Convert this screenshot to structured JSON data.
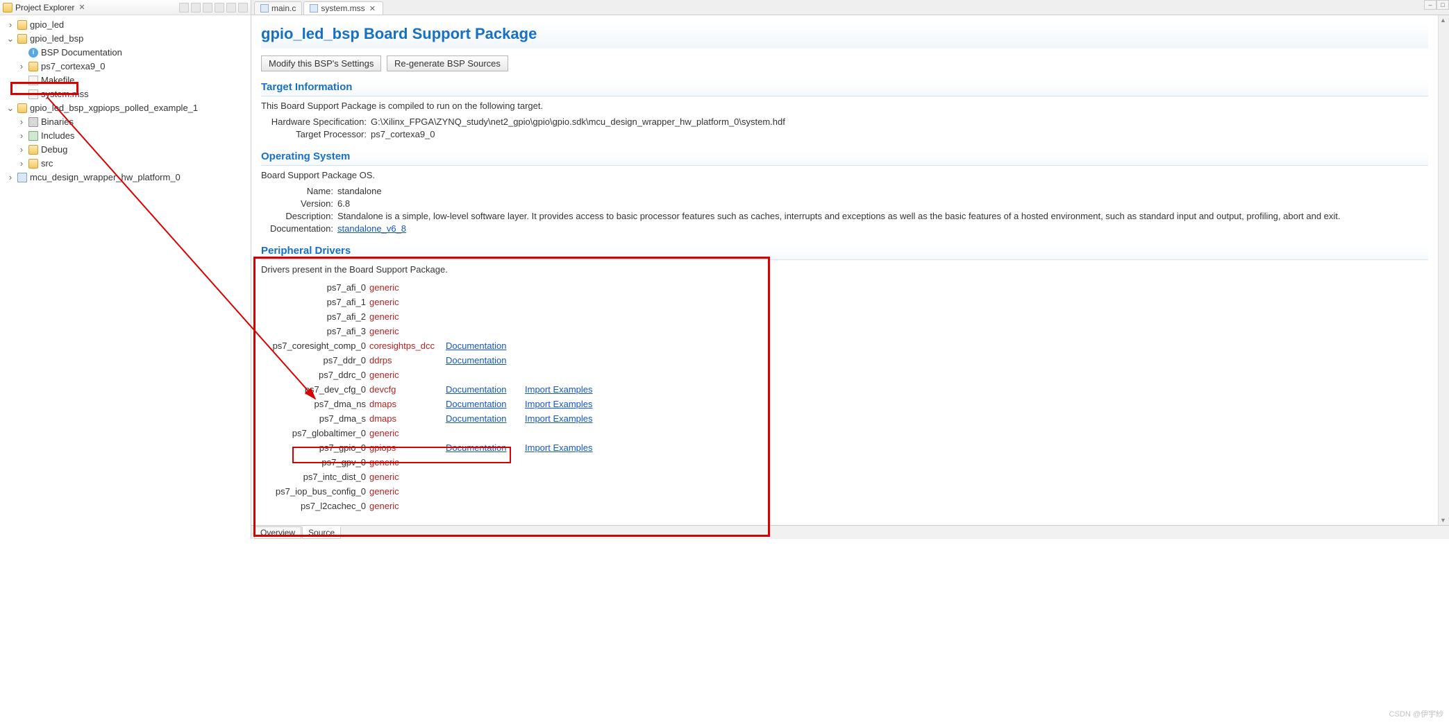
{
  "projectExplorer": {
    "title": "Project Explorer",
    "tree": {
      "gpio_led": "gpio_led",
      "gpio_led_bsp": "gpio_led_bsp",
      "bsp_doc": "BSP Documentation",
      "ps7_cortexa9_0": "ps7_cortexa9_0",
      "makefile": "Makefile",
      "system_mss": "system.mss",
      "example_proj": "gpio_led_bsp_xgpiops_polled_example_1",
      "binaries": "Binaries",
      "includes": "Includes",
      "debug": "Debug",
      "src": "src",
      "hw_platform": "mcu_design_wrapper_hw_platform_0"
    }
  },
  "tabs": {
    "main_c": "main.c",
    "system_mss": "system.mss"
  },
  "page": {
    "title": "gpio_led_bsp Board Support Package",
    "modify_btn": "Modify this BSP's Settings",
    "regen_btn": "Re-generate BSP Sources",
    "target_info_title": "Target Information",
    "target_caption": "This Board Support Package is compiled to run on the following target.",
    "hw_spec_key": "Hardware Specification:",
    "hw_spec_val": "G:\\Xilinx_FPGA\\ZYNQ_study\\net2_gpio\\gpio\\gpio.sdk\\mcu_design_wrapper_hw_platform_0\\system.hdf",
    "target_proc_key": "Target Processor:",
    "target_proc_val": "ps7_cortexa9_0",
    "os_title": "Operating System",
    "os_caption": "Board Support Package OS.",
    "os_name_key": "Name:",
    "os_name_val": "standalone",
    "os_ver_key": "Version:",
    "os_ver_val": "6.8",
    "os_desc_key": "Description:",
    "os_desc_val": "Standalone is a simple, low-level software layer. It provides access to basic processor features such as caches, interrupts and exceptions as well as the basic features of a hosted environment, such as standard input and output, profiling, abort and exit.",
    "os_doc_key": "Documentation:",
    "os_doc_link": "standalone_v6_8",
    "pd_title": "Peripheral Drivers",
    "pd_caption": "Drivers present in the Board Support Package.",
    "doc_link_label": "Documentation",
    "imp_link_label": "Import Examples",
    "drivers": [
      {
        "name": "ps7_afi_0",
        "drv": "generic",
        "doc": false,
        "imp": false
      },
      {
        "name": "ps7_afi_1",
        "drv": "generic",
        "doc": false,
        "imp": false
      },
      {
        "name": "ps7_afi_2",
        "drv": "generic",
        "doc": false,
        "imp": false
      },
      {
        "name": "ps7_afi_3",
        "drv": "generic",
        "doc": false,
        "imp": false
      },
      {
        "name": "ps7_coresight_comp_0",
        "drv": "coresightps_dcc",
        "doc": true,
        "imp": false
      },
      {
        "name": "ps7_ddr_0",
        "drv": "ddrps",
        "doc": true,
        "imp": false
      },
      {
        "name": "ps7_ddrc_0",
        "drv": "generic",
        "doc": false,
        "imp": false
      },
      {
        "name": "ps7_dev_cfg_0",
        "drv": "devcfg",
        "doc": true,
        "imp": true
      },
      {
        "name": "ps7_dma_ns",
        "drv": "dmaps",
        "doc": true,
        "imp": true
      },
      {
        "name": "ps7_dma_s",
        "drv": "dmaps",
        "doc": true,
        "imp": true
      },
      {
        "name": "ps7_globaltimer_0",
        "drv": "generic",
        "doc": false,
        "imp": false
      },
      {
        "name": "ps7_gpio_0",
        "drv": "gpiops",
        "doc": true,
        "imp": true
      },
      {
        "name": "ps7_gpv_0",
        "drv": "generic",
        "doc": false,
        "imp": false
      },
      {
        "name": "ps7_intc_dist_0",
        "drv": "generic",
        "doc": false,
        "imp": false
      },
      {
        "name": "ps7_iop_bus_config_0",
        "drv": "generic",
        "doc": false,
        "imp": false
      },
      {
        "name": "ps7_l2cachec_0",
        "drv": "generic",
        "doc": false,
        "imp": false
      }
    ]
  },
  "bottomTabs": {
    "overview": "Overview",
    "source": "Source"
  },
  "watermark": "CSDN @伊宇紗"
}
